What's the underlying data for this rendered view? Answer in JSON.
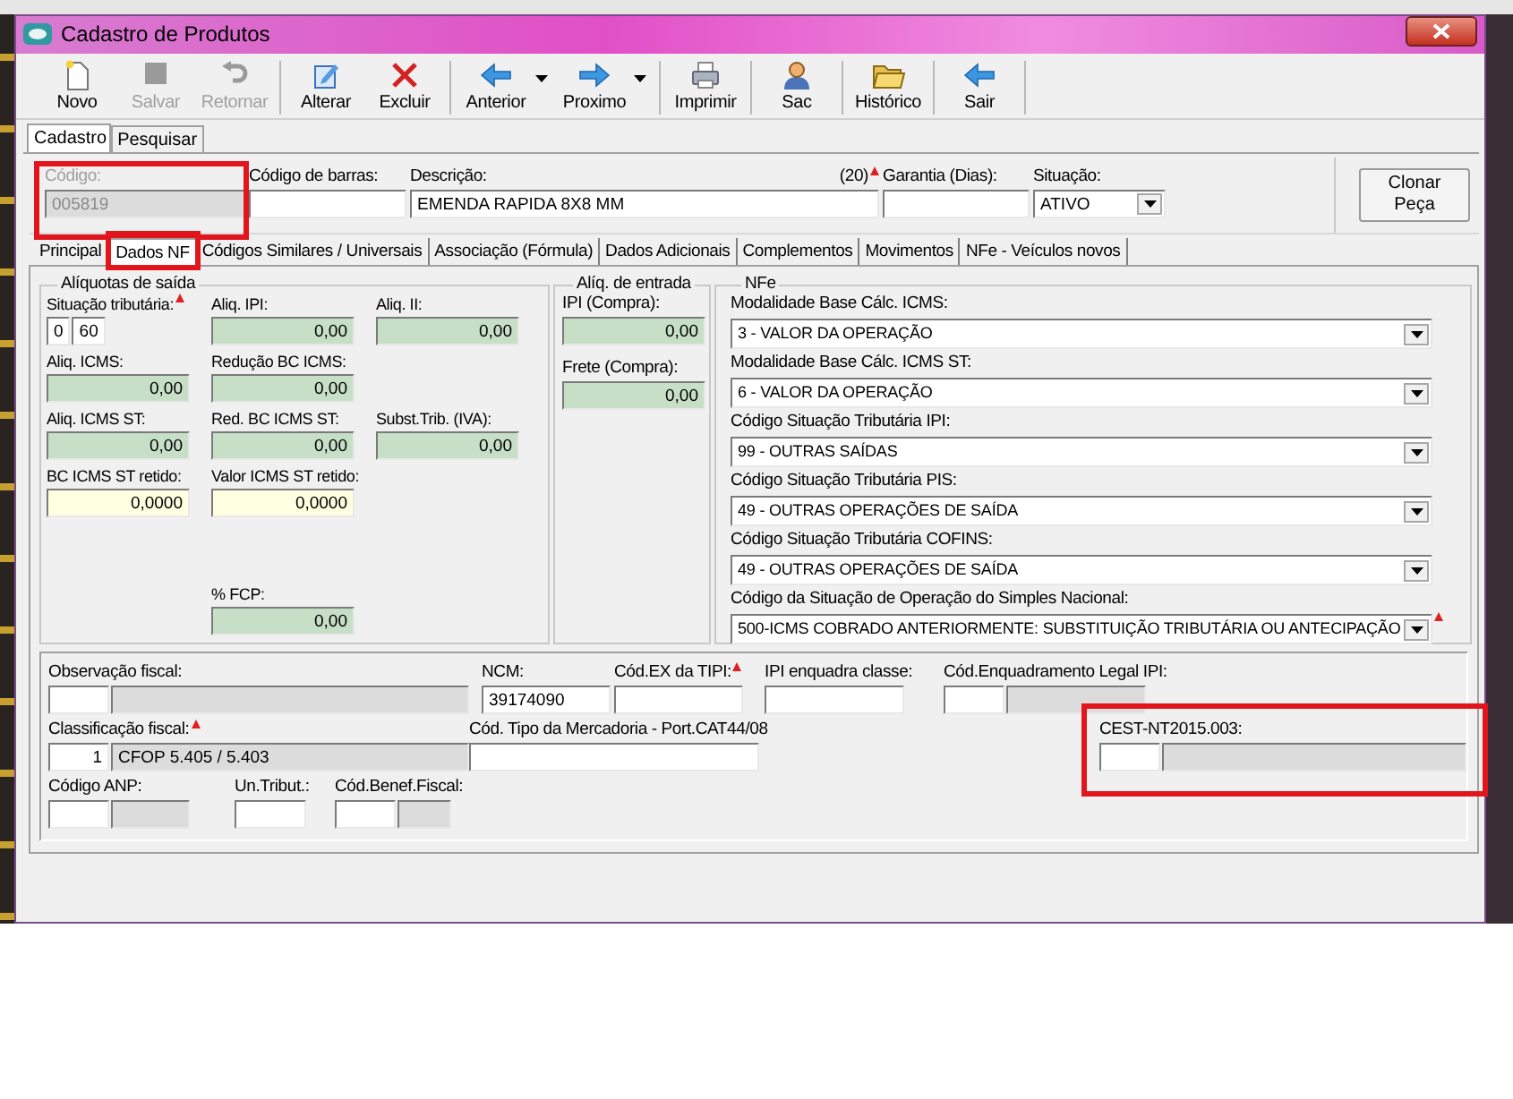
{
  "window": {
    "title": "Cadastro de Produtos"
  },
  "toolbar": [
    {
      "label": "Novo",
      "kind": "new",
      "disabled": false,
      "dropdown": false,
      "separator_after": false
    },
    {
      "label": "Salvar",
      "kind": "save",
      "disabled": true,
      "dropdown": false,
      "separator_after": false
    },
    {
      "label": "Retornar",
      "kind": "undo",
      "disabled": true,
      "dropdown": false,
      "separator_after": true
    },
    {
      "label": "Alterar",
      "kind": "edit",
      "disabled": false,
      "dropdown": false,
      "separator_after": false
    },
    {
      "label": "Excluir",
      "kind": "delete",
      "disabled": false,
      "dropdown": false,
      "separator_after": true
    },
    {
      "label": "Anterior",
      "kind": "back",
      "disabled": false,
      "dropdown": true,
      "separator_after": false
    },
    {
      "label": "Proximo",
      "kind": "forward",
      "disabled": false,
      "dropdown": true,
      "separator_after": true
    },
    {
      "label": "Imprimir",
      "kind": "print",
      "disabled": false,
      "dropdown": false,
      "separator_after": true
    },
    {
      "label": "Sac",
      "kind": "person",
      "disabled": false,
      "dropdown": false,
      "separator_after": true
    },
    {
      "label": "Histórico",
      "kind": "folder",
      "disabled": false,
      "dropdown": false,
      "separator_after": true
    },
    {
      "label": "Sair",
      "kind": "exit",
      "disabled": false,
      "dropdown": false,
      "separator_after": true
    }
  ],
  "main_tabs": [
    {
      "label": "Cadastro",
      "selected": true
    },
    {
      "label": "Pesquisar",
      "selected": false
    }
  ],
  "header": {
    "fields": [
      {
        "kind": "text",
        "label": "Código:",
        "value": "005819",
        "disabled": true,
        "required": false,
        "highlighted": true
      },
      {
        "kind": "text",
        "label": "Código de barras:",
        "disabled": false,
        "required": false,
        "highlighted": false
      },
      {
        "kind": "text",
        "label": "Descrição:",
        "value": "EMENDA RAPIDA 8X8 MM",
        "counter": "(20)",
        "disabled": false,
        "required": true,
        "highlighted": false
      },
      {
        "kind": "text",
        "label": "Garantia (Dias):",
        "disabled": false,
        "required": false,
        "highlighted": false
      },
      {
        "kind": "select",
        "label": "Situação:",
        "value": "ATIVO",
        "disabled": false,
        "required": false,
        "highlighted": false
      }
    ],
    "clone_button": "Clonar Peça"
  },
  "detail_tabs": [
    {
      "label": "Principal",
      "selected": false,
      "highlighted": false
    },
    {
      "label": "Dados NF",
      "selected": true,
      "highlighted": true
    },
    {
      "label": "Códigos Similares / Universais",
      "selected": false,
      "highlighted": false
    },
    {
      "label": "Associação (Fórmula)",
      "selected": false,
      "highlighted": false
    },
    {
      "label": "Dados Adicionais",
      "selected": false,
      "highlighted": false
    },
    {
      "label": "Complementos",
      "selected": false,
      "highlighted": false
    },
    {
      "label": "Movimentos",
      "selected": false,
      "highlighted": false
    },
    {
      "label": "NFe - Veículos novos",
      "selected": false,
      "highlighted": false
    }
  ],
  "saida": {
    "title": "Alíquotas de saída",
    "rows": [
      [
        {
          "kind": "pair",
          "label": "Situação tributária:",
          "values": [
            "0",
            "60"
          ],
          "required": true
        },
        {
          "kind": "readonly",
          "label": "Aliq. IPI:",
          "value": "0,00",
          "required": false
        },
        {
          "kind": "readonly",
          "label": "Aliq. II:",
          "value": "0,00",
          "required": false
        }
      ],
      [
        {
          "kind": "readonly",
          "label": "Aliq. ICMS:",
          "value": "0,00",
          "required": false
        },
        {
          "kind": "readonly",
          "label": "Redução BC ICMS:",
          "value": "0,00",
          "required": false
        }
      ],
      [
        {
          "kind": "readonly",
          "label": "Aliq. ICMS ST:",
          "value": "0,00",
          "required": false
        },
        {
          "kind": "readonly",
          "label": "Red. BC ICMS ST:",
          "value": "0,00",
          "required": false
        },
        {
          "kind": "readonly",
          "label": "Subst.Trib. (IVA):",
          "value": "0,00",
          "required": false
        }
      ],
      [
        {
          "kind": "editable",
          "label": "BC ICMS ST retido:",
          "value": "0,0000",
          "required": false
        },
        {
          "kind": "editable",
          "label": "Valor ICMS ST retido:",
          "value": "0,0000",
          "required": false
        }
      ]
    ],
    "fcp": {
      "kind": "readonly",
      "label": "% FCP:",
      "value": "0,00",
      "required": false
    }
  },
  "entrada": {
    "title": "Alíq. de entrada",
    "fields": [
      {
        "label": "IPI (Compra):",
        "value": "0,00"
      },
      {
        "label": "Frete (Compra):",
        "value": "0,00"
      }
    ]
  },
  "nfe": {
    "title": "NFe",
    "selects": [
      {
        "label": "Modalidade Base Cálc. ICMS:",
        "value": "3 - VALOR DA OPERAÇÃO",
        "required": false
      },
      {
        "label": "Modalidade Base Cálc. ICMS ST:",
        "value": "6 - VALOR DA OPERAÇÃO",
        "required": false
      },
      {
        "label": "Código Situação Tributária IPI:",
        "value": "99 - OUTRAS SAÍDAS",
        "required": false
      },
      {
        "label": "Código Situação Tributária PIS:",
        "value": "49 - OUTRAS OPERAÇÕES DE SAÍDA",
        "required": false
      },
      {
        "label": "Código Situação Tributária COFINS:",
        "value": "49 - OUTRAS OPERAÇÕES DE SAÍDA",
        "required": false
      },
      {
        "label": "Código da Situação de Operação do Simples Nacional:",
        "value": "500-ICMS COBRADO ANTERIORMENTE: SUBSTITUIÇÃO TRIBUTÁRIA OU ANTECIPAÇÃO",
        "required": true
      }
    ]
  },
  "fiscal": {
    "rows": [
      [
        {
          "kind": "lookup",
          "label": "Observação fiscal:",
          "required": false,
          "highlighted": false
        },
        {
          "kind": "text",
          "label": "NCM:",
          "value": "39174090",
          "required": false,
          "highlighted": false
        },
        {
          "kind": "text",
          "label": "Cód.EX da TIPI:",
          "required": true,
          "highlighted": false
        },
        {
          "kind": "text",
          "label": "IPI enquadra classe:",
          "required": false,
          "highlighted": false
        },
        {
          "kind": "lookup",
          "label": "Cód.Enquadramento Legal IPI:",
          "required": false,
          "highlighted": false
        }
      ],
      [
        {
          "kind": "lookup",
          "label": "Classificação fiscal:",
          "code": "1",
          "description": "CFOP  5.405 / 5.403",
          "required": true,
          "highlighted": false
        },
        {
          "kind": "text",
          "label": "Cód. Tipo da Mercadoria - Port.CAT44/08",
          "required": false,
          "highlighted": false
        },
        {
          "kind": "lookup",
          "label": "CEST-NT2015.003:",
          "required": false,
          "highlighted": true
        }
      ],
      [
        {
          "kind": "lookup",
          "label": "Código ANP:",
          "required": false,
          "highlighted": false
        },
        {
          "kind": "text",
          "label": "Un.Tribut.:",
          "required": false,
          "highlighted": false
        },
        {
          "kind": "lookup",
          "label": "Cód.Benef.Fiscal:",
          "required": false,
          "highlighted": false
        }
      ]
    ]
  }
}
